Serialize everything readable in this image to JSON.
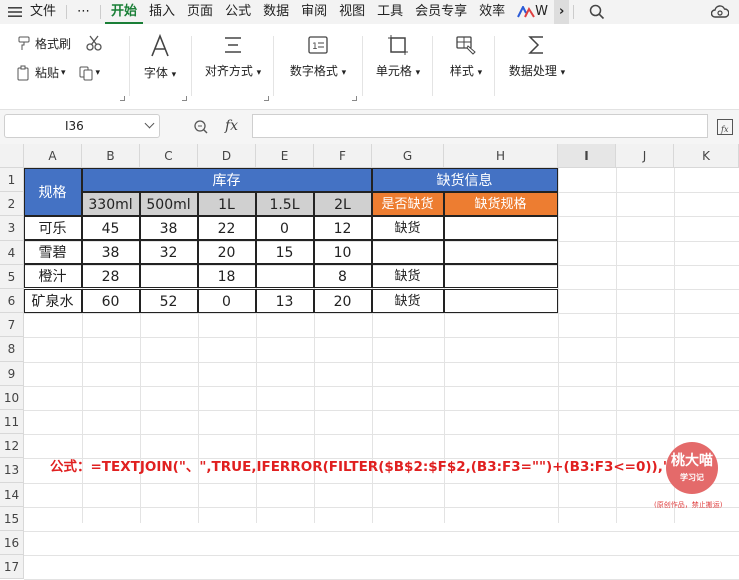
{
  "menu": {
    "file": "文件",
    "more": "⋯",
    "tabs": [
      "开始",
      "插入",
      "页面",
      "公式",
      "数据",
      "审阅",
      "视图",
      "工具",
      "会员专享",
      "效率"
    ],
    "truncated": "W",
    "more_arrow": "›"
  },
  "ribbon": {
    "format_painter": "格式刷",
    "paste": "粘贴",
    "font": "字体",
    "align": "对齐方式",
    "number": "数字格式",
    "cell": "单元格",
    "style": "样式",
    "data": "数据处理"
  },
  "formula_bar": {
    "name_box": "I36",
    "fx": "fx",
    "value": ""
  },
  "columns": [
    "A",
    "B",
    "C",
    "D",
    "E",
    "F",
    "G",
    "H",
    "I",
    "J",
    "K"
  ],
  "rows": [
    "1",
    "2",
    "3",
    "4",
    "5",
    "6",
    "7",
    "8",
    "9",
    "10",
    "11",
    "12",
    "13",
    "14",
    "15",
    "16",
    "17"
  ],
  "table": {
    "header_spec": "规格",
    "header_stock": "库存",
    "header_shortage": "缺货信息",
    "sizes": [
      "330ml",
      "500ml",
      "1L",
      "1.5L",
      "2L"
    ],
    "is_short": "是否缺货",
    "short_spec": "缺货规格",
    "data_rows": [
      {
        "name": "可乐",
        "values": [
          "45",
          "38",
          "22",
          "0",
          "12"
        ],
        "short": "缺货"
      },
      {
        "name": "雪碧",
        "values": [
          "38",
          "32",
          "20",
          "15",
          "10"
        ],
        "short": ""
      },
      {
        "name": "橙汁",
        "values": [
          "28",
          "",
          "18",
          "",
          "8"
        ],
        "short": "缺货"
      },
      {
        "name": "矿泉水",
        "values": [
          "60",
          "52",
          "0",
          "13",
          "20"
        ],
        "short": "缺货"
      }
    ]
  },
  "formula_note": "公式：=TEXTJOIN(\"、\",TRUE,IFERROR(FILTER($B$2:$F$2,(B3:F3=\"\")+(B3:F3<=0)),\"\"))",
  "stamp": {
    "name": "桃大喵",
    "sub": "学习记",
    "note": "(原创作品，禁止搬运)"
  },
  "colors": {
    "blue": "#4472c4",
    "orange": "#ed7d31",
    "grey_header": "#d0d0d0",
    "green": "#1a7f37"
  }
}
